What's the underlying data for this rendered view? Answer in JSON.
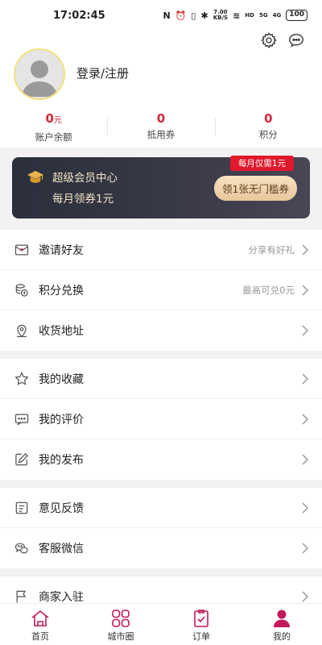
{
  "status_bar": {
    "time": "17:02:45",
    "speed_value": "7.00",
    "speed_unit": "KB/S",
    "hd": "HD",
    "net1": "5G",
    "net2": "4G",
    "battery": "100"
  },
  "profile": {
    "login_label": "登录/注册",
    "stats": [
      {
        "value": "0",
        "unit": "元",
        "label": "账户余额"
      },
      {
        "value": "0",
        "unit": "",
        "label": "抵用券"
      },
      {
        "value": "0",
        "unit": "",
        "label": "积分"
      }
    ]
  },
  "vip": {
    "title": "超级会员中心",
    "subtitle": "每月领券1元",
    "tag": "每月仅需1元",
    "button": "领1张无门槛券"
  },
  "menu_groups": [
    [
      {
        "name": "invite-friends",
        "icon": "mail-heart-icon",
        "label": "邀请好友",
        "hint": "分享有好礼"
      },
      {
        "name": "points-exchange",
        "icon": "coins-icon",
        "label": "积分兑换",
        "hint": "最高可兑0元"
      },
      {
        "name": "shipping-address",
        "icon": "location-pin-icon",
        "label": "收货地址",
        "hint": ""
      }
    ],
    [
      {
        "name": "my-favorites",
        "icon": "star-icon",
        "label": "我的收藏",
        "hint": ""
      },
      {
        "name": "my-reviews",
        "icon": "chat-bubble-icon",
        "label": "我的评价",
        "hint": ""
      },
      {
        "name": "my-posts",
        "icon": "edit-icon",
        "label": "我的发布",
        "hint": ""
      }
    ],
    [
      {
        "name": "feedback",
        "icon": "feedback-icon",
        "label": "意见反馈",
        "hint": ""
      },
      {
        "name": "customer-service-wechat",
        "icon": "wechat-icon",
        "label": "客服微信",
        "hint": ""
      }
    ],
    [
      {
        "name": "merchant-join",
        "icon": "flag-icon",
        "label": "商家入驻",
        "hint": ""
      }
    ]
  ],
  "tabbar": {
    "items": [
      {
        "label": "首页",
        "icon": "home-icon"
      },
      {
        "label": "城市圈",
        "icon": "grid-icon"
      },
      {
        "label": "订单",
        "icon": "clipboard-icon"
      },
      {
        "label": "我的",
        "icon": "user-icon"
      }
    ],
    "active_index": 3,
    "accent": "#c2185b"
  },
  "colors": {
    "accent_red": "#d6283c",
    "vip_gold": "#f3e6c6"
  }
}
